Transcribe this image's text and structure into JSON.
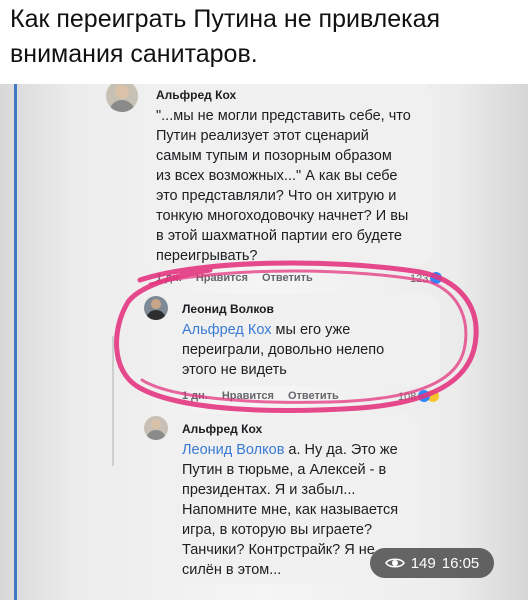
{
  "post": {
    "title": "Как переиграть Путина не привлекая внимания санитаров."
  },
  "comments": [
    {
      "author": "Альфред Кох",
      "text_parts": [
        "\"...мы не могли представить себе, что",
        "Путин реализует этот сценарий",
        "самым тупым и позорным образом",
        "из всех возможных...\" А как вы себе",
        "это представляли? Что он хитрую и",
        "тонкую многоходовочку начнет? И вы",
        "в этой шахматной партии его будете",
        "переигрывать?"
      ],
      "time": "1 дн.",
      "like_label": "Нравится",
      "reply_label": "Ответить",
      "reactions": "123"
    },
    {
      "author": "Леонид Волков",
      "mention": "Альфред Кох",
      "line1_rest": " мы его уже",
      "lines": [
        "переиграли, довольно нелепо",
        "этого не видеть"
      ],
      "time": "1 дн.",
      "like_label": "Нравится",
      "reply_label": "Ответить",
      "reactions": "108"
    },
    {
      "author": "Альфред Кох",
      "mention": "Леонид Волков",
      "line1_rest": " а. Ну да. Это же",
      "lines": [
        "Путин в тюрьме, а Алексей - в",
        "президентах. Я и забыл...",
        "Напомните мне, как называется",
        "игра, в которую вы играете?",
        "Танчики? Контрстрайк? Я не",
        "силён в этом..."
      ]
    }
  ],
  "overlay": {
    "views": "149",
    "time": "16:05"
  },
  "colors": {
    "link": "#3a7bd5",
    "marker": "#e3367f",
    "thread_line": "#3f78c4"
  }
}
